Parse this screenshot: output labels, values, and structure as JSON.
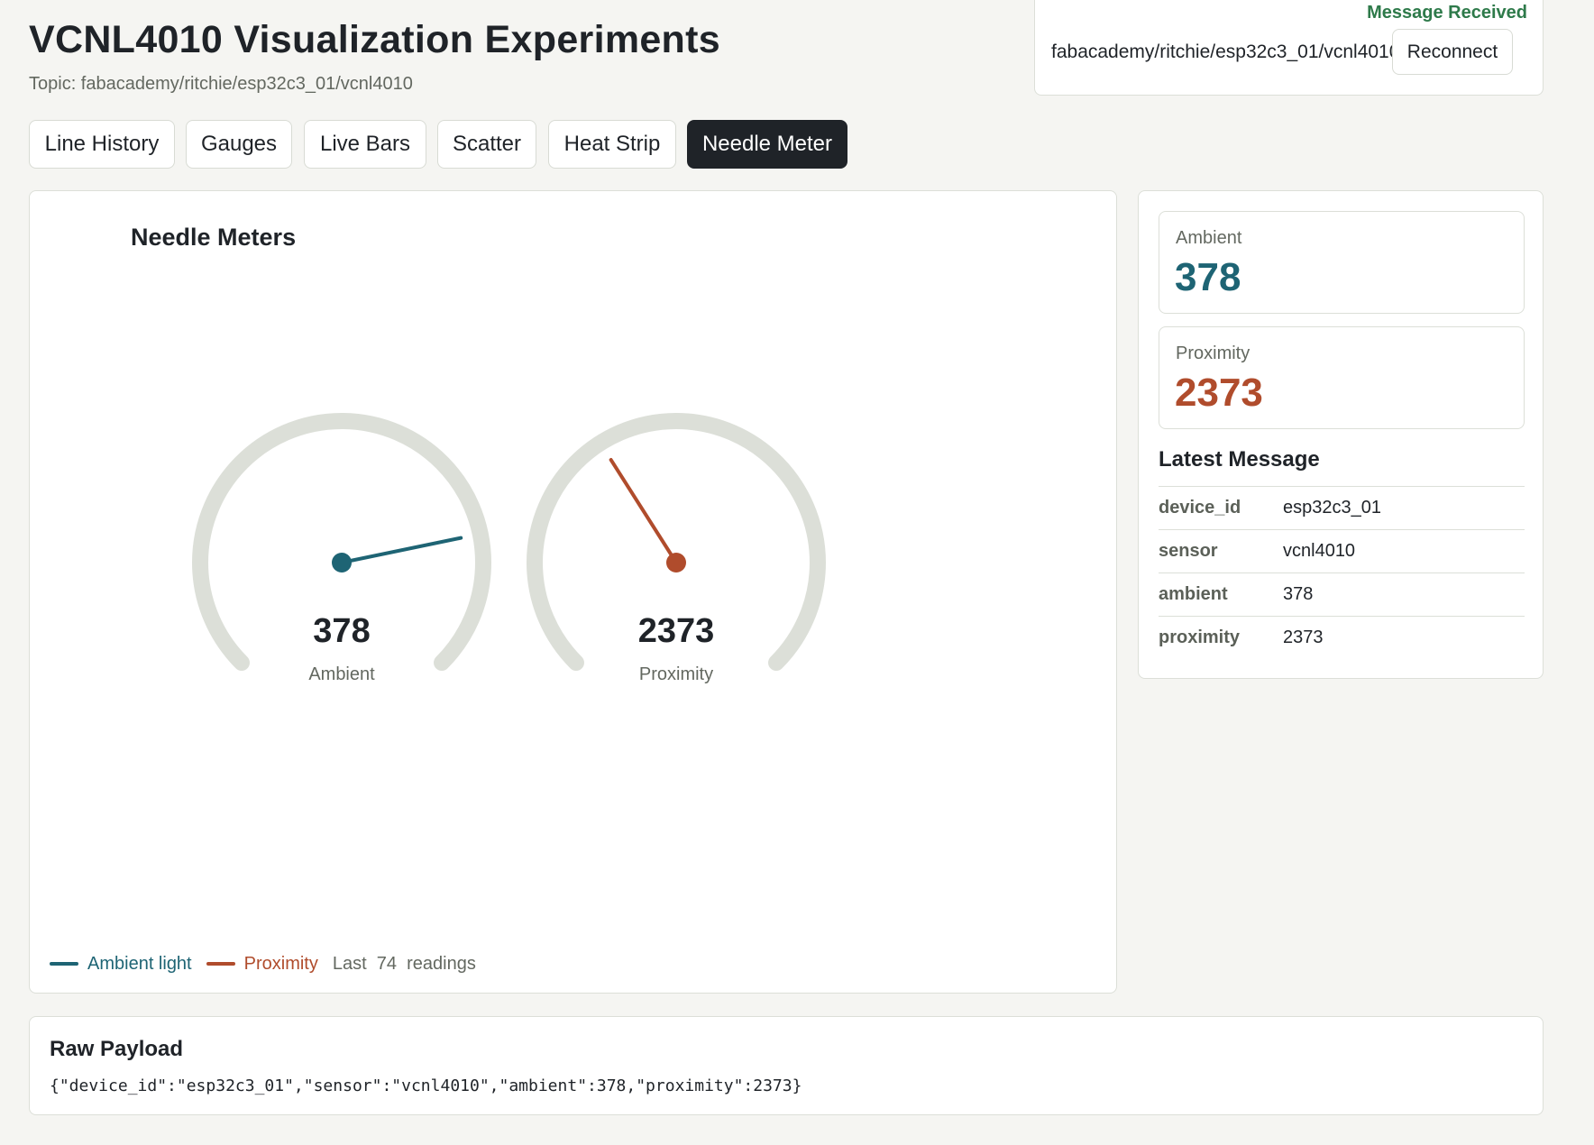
{
  "header": {
    "title": "VCNL4010 Visualization Experiments",
    "topic_label": "Topic: fabacademy/ritchie/esp32c3_01/vcnl4010"
  },
  "connection": {
    "status": "Message Received",
    "topic": "fabacademy/ritchie/esp32c3_01/vcnl4010",
    "reconnect_label": "Reconnect"
  },
  "tabs": [
    {
      "label": "Line History",
      "active": false
    },
    {
      "label": "Gauges",
      "active": false
    },
    {
      "label": "Live Bars",
      "active": false
    },
    {
      "label": "Scatter",
      "active": false
    },
    {
      "label": "Heat Strip",
      "active": false
    },
    {
      "label": "Needle Meter",
      "active": true
    }
  ],
  "chart_data": {
    "type": "gauge",
    "title": "Needle Meters",
    "gauges": [
      {
        "label": "Ambient",
        "value": 378,
        "display": "378",
        "fraction": 0.79,
        "color": "#1e6474"
      },
      {
        "label": "Proximity",
        "value": 2373,
        "display": "2373",
        "fraction": 0.38,
        "color": "#b04c2c"
      }
    ]
  },
  "legend": {
    "ambient": "Ambient light",
    "proximity": "Proximity",
    "readings": "Last  74  readings"
  },
  "stats": {
    "ambient": {
      "label": "Ambient",
      "value": "378"
    },
    "proximity": {
      "label": "Proximity",
      "value": "2373"
    }
  },
  "latest_message": {
    "title": "Latest Message",
    "rows": [
      {
        "key": "device_id",
        "value": "esp32c3_01"
      },
      {
        "key": "sensor",
        "value": "vcnl4010"
      },
      {
        "key": "ambient",
        "value": "378"
      },
      {
        "key": "proximity",
        "value": "2373"
      }
    ]
  },
  "raw": {
    "title": "Raw Payload",
    "payload": "{\"device_id\":\"esp32c3_01\",\"sensor\":\"vcnl4010\",\"ambient\":378,\"proximity\":2373}"
  },
  "colors": {
    "ambient": "#1e6474",
    "proximity": "#b04c2c",
    "status": "#2e7a4a",
    "track": "#dcdfd8"
  }
}
